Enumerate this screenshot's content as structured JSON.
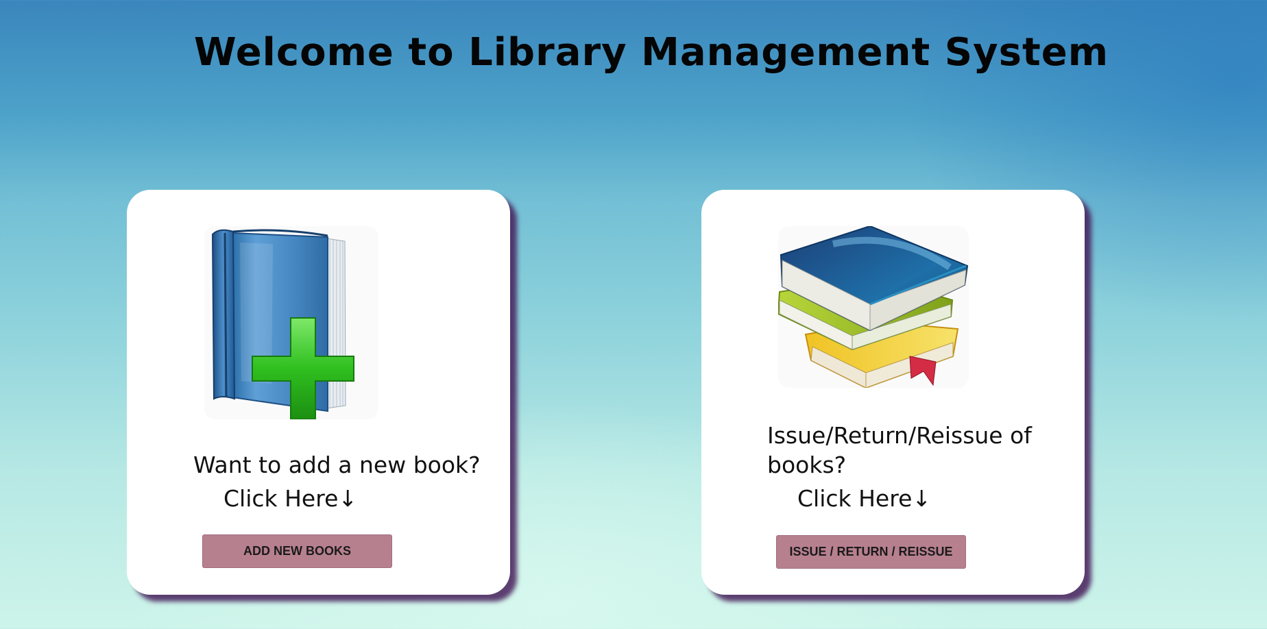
{
  "page": {
    "title": "Welcome to Library Management System"
  },
  "cards": {
    "add": {
      "icon": "add-book-icon",
      "description": "Want to add a new book?",
      "prompt": "Click Here↓",
      "button_label": "ADD NEW BOOKS"
    },
    "issue": {
      "icon": "book-stack-icon",
      "description": "Issue/Return/Reissue of books?",
      "prompt": "Click Here↓",
      "button_label": "ISSUE / RETURN / REISSUE"
    }
  },
  "colors": {
    "button": "#b7808f",
    "card_shadow": "#46205a",
    "background_top": "#3a86bd",
    "background_bottom": "#cdf4ea"
  }
}
